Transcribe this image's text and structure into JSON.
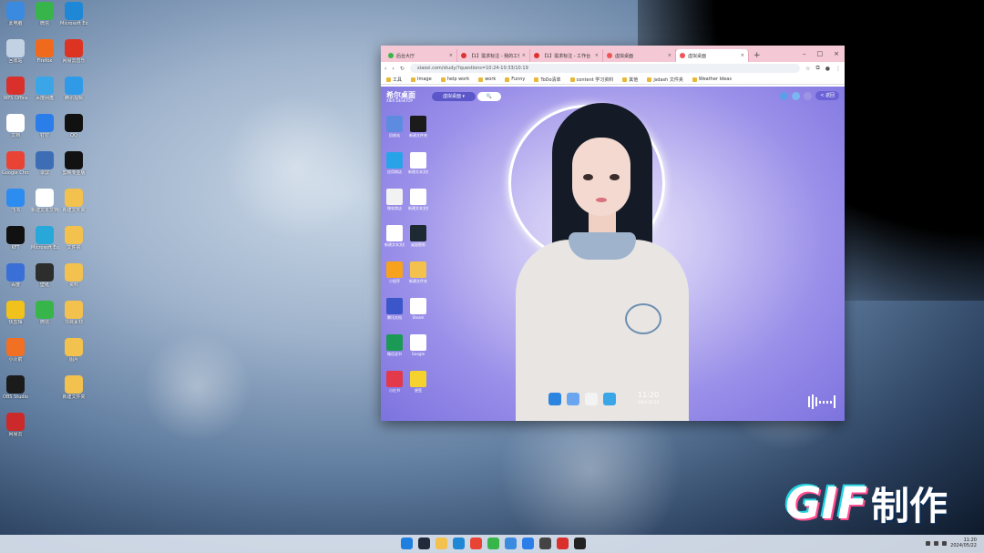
{
  "desktop": {
    "icons": [
      {
        "label": "此电脑",
        "color": "#3a8be0",
        "col": 0,
        "row": 0
      },
      {
        "label": "微信",
        "color": "#38b54a",
        "col": 1,
        "row": 0
      },
      {
        "label": "Microsoft Edge",
        "color": "#1e88d6",
        "col": 2,
        "row": 0
      },
      {
        "label": "回收站",
        "color": "#c3d2e3",
        "col": 0,
        "row": 1
      },
      {
        "label": "Firefox",
        "color": "#f06a1d",
        "col": 1,
        "row": 1
      },
      {
        "label": "网易云音乐",
        "color": "#dd3322",
        "col": 2,
        "row": 1
      },
      {
        "label": "WPS Office",
        "color": "#d9302c",
        "col": 0,
        "row": 2
      },
      {
        "label": "百度网盘",
        "color": "#3aa6e8",
        "col": 1,
        "row": 2
      },
      {
        "label": "腾讯视频",
        "color": "#2f9be8",
        "col": 2,
        "row": 2
      },
      {
        "label": "文档",
        "color": "#ffffff",
        "col": 0,
        "row": 3
      },
      {
        "label": "钉钉",
        "color": "#2b7de9",
        "col": 1,
        "row": 3
      },
      {
        "label": "QQ",
        "color": "#111111",
        "col": 2,
        "row": 3
      },
      {
        "label": "Google Chrome",
        "color": "#e84335",
        "col": 0,
        "row": 4
      },
      {
        "label": "录屏",
        "color": "#3d6db5",
        "col": 1,
        "row": 4
      },
      {
        "label": "剪映专业版",
        "color": "#121212",
        "col": 2,
        "row": 4
      },
      {
        "label": "飞书",
        "color": "#2d8cf0",
        "col": 0,
        "row": 5
      },
      {
        "label": "新建文本文档",
        "color": "#ffffff",
        "col": 1,
        "row": 5
      },
      {
        "label": "新建文件夹",
        "color": "#f2c14e",
        "col": 2,
        "row": 5
      },
      {
        "label": "KFT",
        "color": "#111111",
        "col": 0,
        "row": 6
      },
      {
        "label": "Microsoft Edge",
        "color": "#28a8d8",
        "col": 1,
        "row": 6
      },
      {
        "label": "文件夹",
        "color": "#f2c14e",
        "col": 2,
        "row": 6
      },
      {
        "label": "百度",
        "color": "#3a6fd8",
        "col": 0,
        "row": 7
      },
      {
        "label": "壁纸",
        "color": "#2d2d2d",
        "col": 1,
        "row": 7
      },
      {
        "label": "资料",
        "color": "#f2c14e",
        "col": 2,
        "row": 7
      },
      {
        "label": "快剪辑",
        "color": "#f0c21b",
        "col": 0,
        "row": 8
      },
      {
        "label": "微信",
        "color": "#38b54a",
        "col": 1,
        "row": 8
      },
      {
        "label": "项目素材",
        "color": "#f2c14e",
        "col": 2,
        "row": 8
      },
      {
        "label": "小火箭",
        "color": "#f27024",
        "col": 0,
        "row": 9
      },
      {
        "label": "图片",
        "color": "#f2c14e",
        "col": 2,
        "row": 9
      },
      {
        "label": "OBS Studio",
        "color": "#1b1b1b",
        "col": 0,
        "row": 10
      },
      {
        "label": "新建文件夹",
        "color": "#f2c14e",
        "col": 2,
        "row": 10
      },
      {
        "label": "网易云",
        "color": "#cc2a2a",
        "col": 0,
        "row": 11
      }
    ]
  },
  "browser": {
    "tabs": [
      {
        "label": "后台大厅",
        "active": false,
        "color": "#3bb54a"
      },
      {
        "label": "【1】需求标注 - 我的工作",
        "active": false,
        "color": "#d33"
      },
      {
        "label": "【1】需求标注 - 工作台",
        "active": false,
        "color": "#d33"
      },
      {
        "label": "虚拟桌面",
        "active": false,
        "color": "#e55"
      },
      {
        "label": "虚拟桌面",
        "active": true,
        "color": "#e55"
      }
    ],
    "new_tab": "+",
    "window_controls": {
      "minimize": "–",
      "maximize": "□",
      "close": "×"
    },
    "url": "xiaoxi.com/study/?questions=10:24-10:33/10:19",
    "bookmarks": [
      "工具",
      "Image",
      "help work",
      "work",
      "Funny",
      "ToDo清单",
      "content 学习资料",
      "其他",
      "jsdash 文件夹",
      "Weather Ideas"
    ],
    "page": {
      "logo": "希尔桌面",
      "logo_sub": "XIER DESKTOP",
      "pill_label": "虚拟桌面 ▾",
      "search_label": "🔍",
      "back_label": "< 返回",
      "clock": "11:20",
      "date": "2024-05-22",
      "icons": [
        {
          "label": "回收站",
          "color": "#5d8be0"
        },
        {
          "label": "新建文件夹",
          "color": "#1b1b1b"
        },
        {
          "label": "应用商店",
          "color": "#29a3e8"
        },
        {
          "label": "新建文本文档",
          "color": "#ffffff"
        },
        {
          "label": "微软商店",
          "color": "#f2f2f2"
        },
        {
          "label": "新建文本文档",
          "color": "#ffffff"
        },
        {
          "label": "新建文本文档",
          "color": "#ffffff"
        },
        {
          "label": "桌面壁纸",
          "color": "#1d2a34"
        },
        {
          "label": "小程序",
          "color": "#f6a21c"
        },
        {
          "label": "新建文件夹",
          "color": "#f2c14e"
        },
        {
          "label": "腾讯文档",
          "color": "#3b56c9"
        },
        {
          "label": "Steam",
          "color": "#ffffff"
        },
        {
          "label": "微信读书",
          "color": "#1a9a54"
        },
        {
          "label": "Google",
          "color": "#ffffff"
        },
        {
          "label": "小红书",
          "color": "#e23a4b"
        },
        {
          "label": "便签",
          "color": "#f5d22e"
        }
      ],
      "dock": [
        {
          "name": "windows",
          "color": "#2a84e0"
        },
        {
          "name": "recycle",
          "color": "#6aa6ef"
        },
        {
          "name": "store",
          "color": "#f3f3f3"
        },
        {
          "name": "app",
          "color": "#3aa6e8"
        }
      ]
    }
  },
  "watermark": {
    "gif": "GIF",
    "text": "制作"
  },
  "taskbar": {
    "apps": [
      {
        "name": "windows",
        "color": "#1e7fe0"
      },
      {
        "name": "terminal",
        "color": "#1f2a3a"
      },
      {
        "name": "files",
        "color": "#f2c14e"
      },
      {
        "name": "vscode",
        "color": "#1e88d6"
      },
      {
        "name": "chrome",
        "color": "#e84335"
      },
      {
        "name": "wechat",
        "color": "#38b54a"
      },
      {
        "name": "app",
        "color": "#3a8be0"
      },
      {
        "name": "app2",
        "color": "#2b7de9"
      },
      {
        "name": "app3",
        "color": "#444444"
      },
      {
        "name": "wps",
        "color": "#d9302c"
      },
      {
        "name": "obs",
        "color": "#222222"
      }
    ],
    "time": "11:20",
    "date": "2024/05/22"
  }
}
